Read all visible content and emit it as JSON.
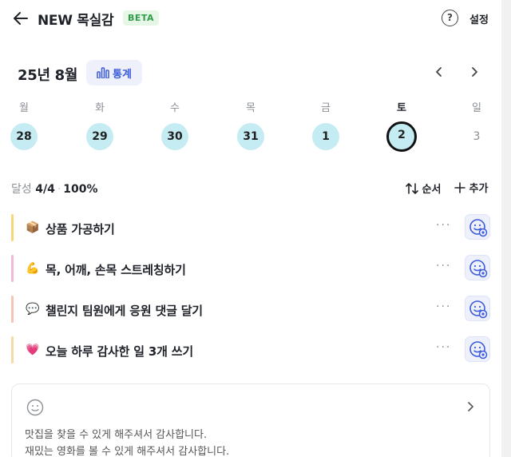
{
  "header": {
    "title": "NEW 목실감",
    "badge": "BETA",
    "help_icon": "?",
    "settings_label": "설정"
  },
  "calendar": {
    "month_label": "25년 8월",
    "stats_label": "통계",
    "weekdays": [
      "월",
      "화",
      "수",
      "목",
      "금",
      "토",
      "일"
    ],
    "dates": [
      "28",
      "29",
      "30",
      "31",
      "1",
      "2",
      "3"
    ],
    "selected_weekday": "토",
    "selected_date": "2"
  },
  "summary": {
    "label": "달성",
    "count": "4/4",
    "percent": "100%",
    "sort_label": "순서",
    "add_label": "추가"
  },
  "tasks": [
    {
      "emoji": "📦",
      "label": "상품 가공하기",
      "bar_color": "#f5d77a"
    },
    {
      "emoji": "💪",
      "label": "목, 어깨, 손목 스트레칭하기",
      "bar_color": "#f2b8d6"
    },
    {
      "emoji": "💬",
      "label": "챌린지 팀원에게 응원 댓글 달기",
      "bar_color": "#f7c3b6"
    },
    {
      "emoji": "💗",
      "label": "오늘 하루 감사한 일 3개 쓰기",
      "bar_color": "#f5d9a6"
    }
  ],
  "note": {
    "line1": "맛집을 찾을 수 있게 해주셔서 감사합니다.",
    "line2": "재밌는 영화를 볼 수 있게 해주셔서 감사합니다."
  },
  "colors": {
    "accent_blue": "#3b5bd9",
    "day_circle": "#c5ecf3",
    "beta_green": "#2e9e48"
  }
}
